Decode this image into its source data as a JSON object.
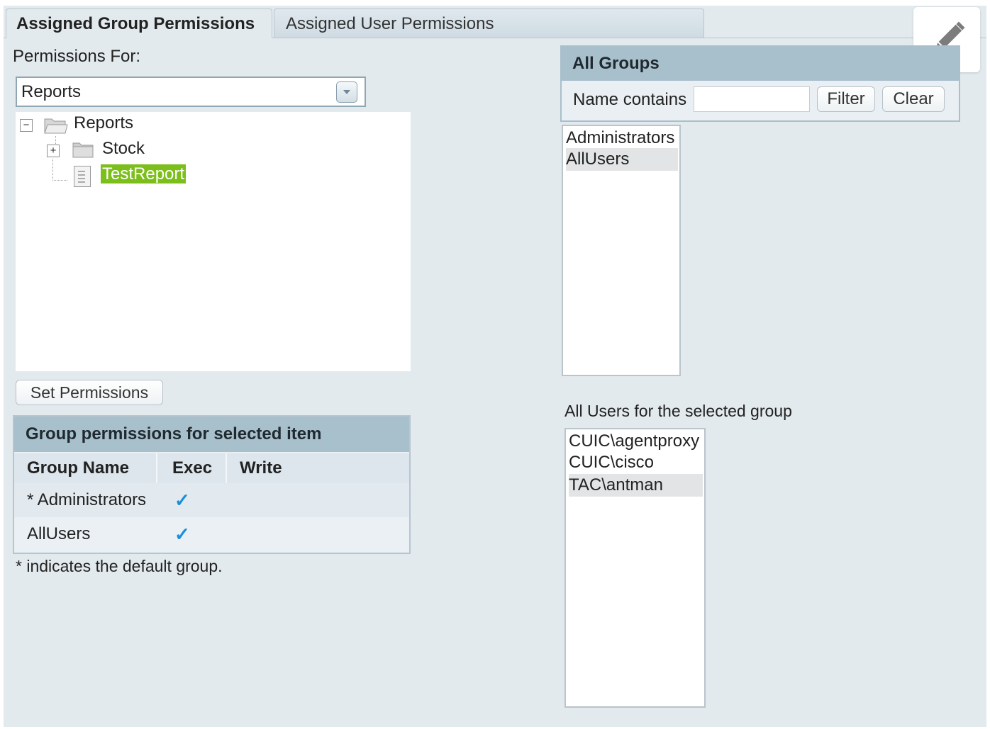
{
  "tabs": {
    "group": "Assigned Group Permissions",
    "user": "Assigned User Permissions"
  },
  "left": {
    "permissions_for_label": "Permissions For:",
    "select_value": "Reports",
    "tree": {
      "root": "Reports",
      "child_folder": "Stock",
      "selected_item": "TestReport"
    },
    "set_permissions_button": "Set Permissions"
  },
  "group_permissions": {
    "title": "Group permissions for selected item",
    "columns": [
      "Group Name",
      "Exec",
      "Write"
    ],
    "rows": [
      {
        "name": "* Administrators",
        "exec": "✓",
        "write": ""
      },
      {
        "name": "AllUsers",
        "exec": "✓",
        "write": ""
      }
    ],
    "footnote": "* indicates the default group."
  },
  "all_groups": {
    "title": "All Groups",
    "name_contains_label": "Name contains",
    "filter_value": "",
    "filter_button": "Filter",
    "clear_button": "Clear",
    "items": [
      "Administrators",
      "AllUsers"
    ],
    "selected_index": 1
  },
  "users": {
    "label": "All Users for the selected group",
    "items": [
      "CUIC\\agentproxy",
      "CUIC\\cisco",
      "TAC\\antman"
    ],
    "selected_index": 2
  },
  "icons": {
    "edit": "pencil-icon",
    "folder": "folder-icon",
    "document": "report-icon",
    "expand": "expand-icon",
    "collapse": "collapse-icon",
    "dropdown": "chevron-down-icon"
  },
  "colors": {
    "header": "#a8bfcc",
    "highlight": "#7cbf1a",
    "check": "#1a8fd8"
  }
}
